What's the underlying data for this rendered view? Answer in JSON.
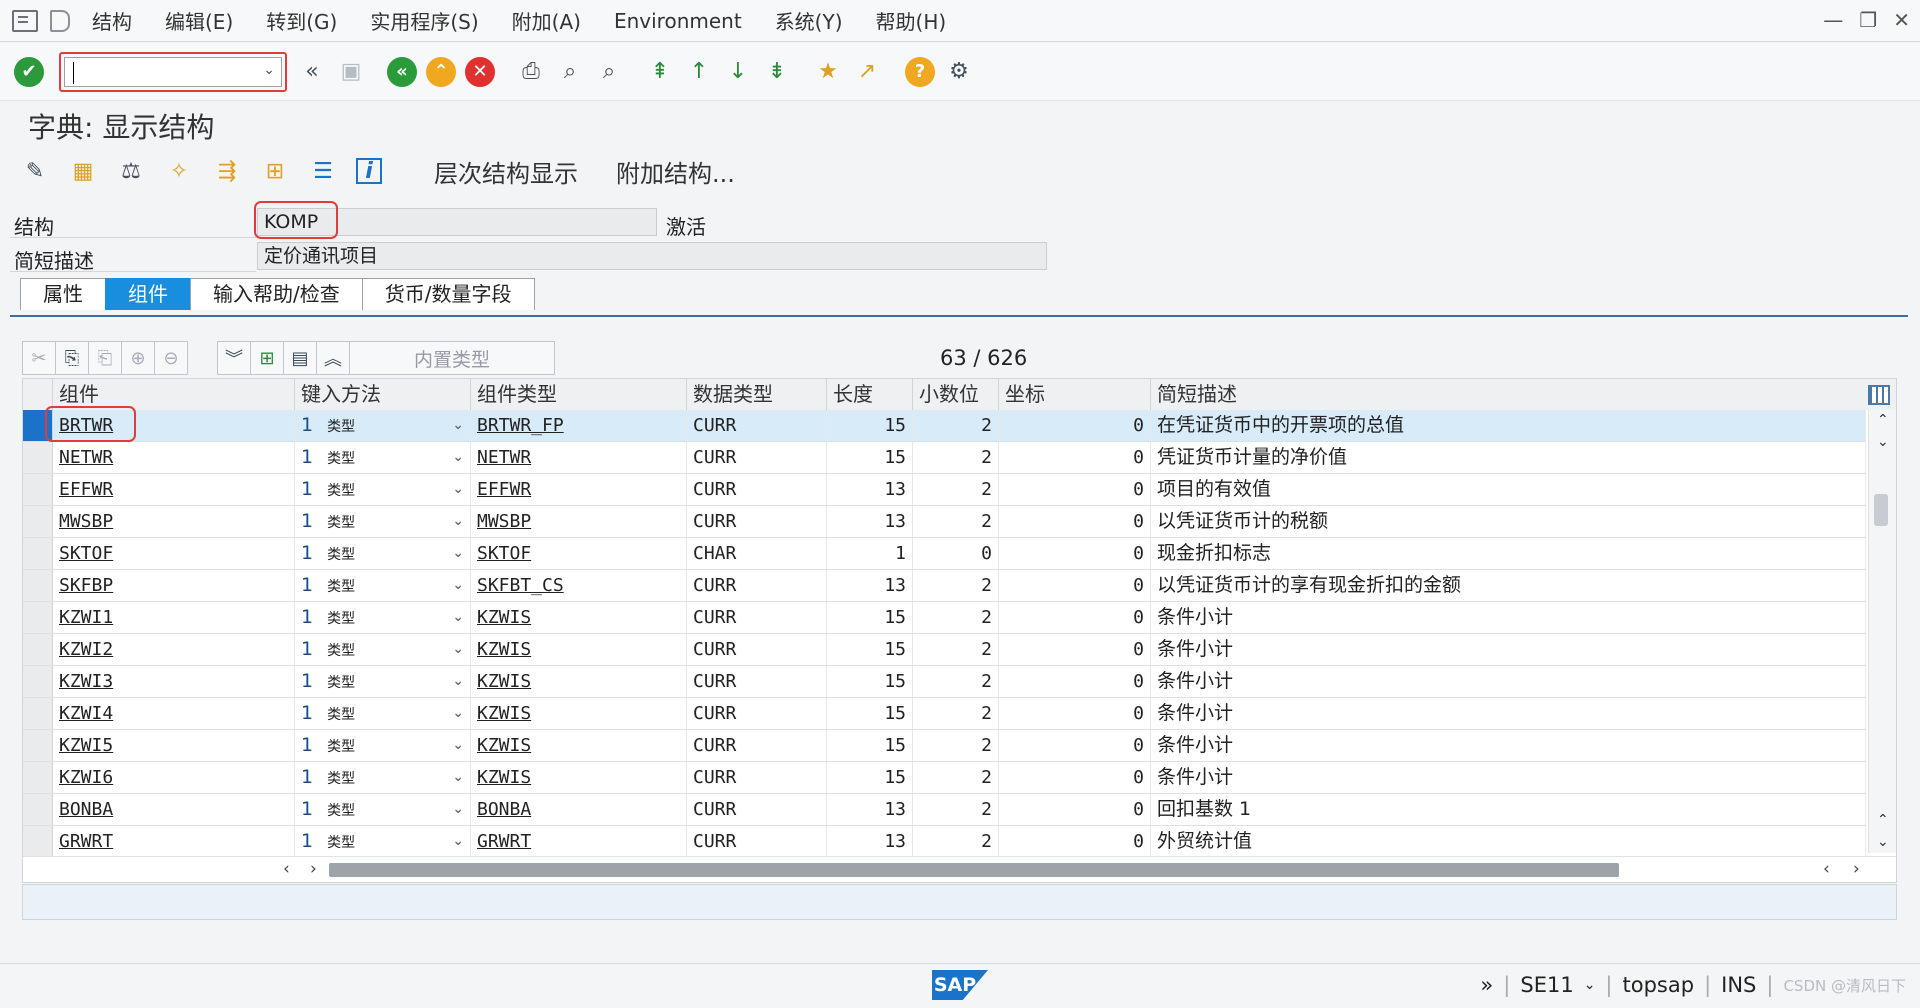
{
  "menu": {
    "items": [
      "结构",
      "编辑(E)",
      "转到(G)",
      "实用程序(S)",
      "附加(A)",
      "Environment",
      "系统(Y)",
      "帮助(H)"
    ]
  },
  "window_controls": [
    "—",
    "❐",
    "✕"
  ],
  "toolbar": {
    "command_value": "",
    "icons": [
      "enter-icon",
      "command-field",
      "back-arrows-icon",
      "save-icon",
      "back-icon",
      "exit-icon",
      "cancel-icon",
      "print-icon",
      "find-icon",
      "find-next-icon",
      "first-page-icon",
      "prev-page-icon",
      "next-page-icon",
      "last-page-icon",
      "create-session-icon",
      "shortcut-icon",
      "help-icon",
      "settings-icon"
    ]
  },
  "title": "字典: 显示结构",
  "app_toolbar": {
    "hierarchy_label": "层次结构显示",
    "append_label": "附加结构..."
  },
  "header": {
    "structure_label": "结构",
    "structure_value": "KOMP",
    "status": "激活",
    "desc_label": "简短描述",
    "desc_value": "定价通讯项目"
  },
  "tabs": [
    {
      "label": "属性",
      "active": false
    },
    {
      "label": "组件",
      "active": true
    },
    {
      "label": "输入帮助/检查",
      "active": false
    },
    {
      "label": "货币/数量字段",
      "active": false
    }
  ],
  "table_toolbar": {
    "predefined_type_label": "内置类型",
    "counter": "63  /  626"
  },
  "grid": {
    "columns": [
      "组件",
      "键入方法",
      "组件类型",
      "数据类型",
      "长度",
      "小数位",
      "坐标",
      "简短描述"
    ],
    "rows": [
      {
        "comp": "BRTWR",
        "typing": "1",
        "kind": "类型",
        "ctype": "BRTWR_FP",
        "dtype": "CURR",
        "len": "15",
        "dec": "2",
        "coord": "0",
        "desc": "在凭证货币中的开票项的总值",
        "selected": true
      },
      {
        "comp": "NETWR",
        "typing": "1",
        "kind": "类型",
        "ctype": "NETWR",
        "dtype": "CURR",
        "len": "15",
        "dec": "2",
        "coord": "0",
        "desc": "凭证货币计量的净价值"
      },
      {
        "comp": "EFFWR",
        "typing": "1",
        "kind": "类型",
        "ctype": "EFFWR",
        "dtype": "CURR",
        "len": "13",
        "dec": "2",
        "coord": "0",
        "desc": "项目的有效值"
      },
      {
        "comp": "MWSBP",
        "typing": "1",
        "kind": "类型",
        "ctype": "MWSBP",
        "dtype": "CURR",
        "len": "13",
        "dec": "2",
        "coord": "0",
        "desc": "以凭证货币计的税额"
      },
      {
        "comp": "SKTOF",
        "typing": "1",
        "kind": "类型",
        "ctype": "SKTOF",
        "dtype": "CHAR",
        "len": "1",
        "dec": "0",
        "coord": "0",
        "desc": "现金折扣标志"
      },
      {
        "comp": "SKFBP",
        "typing": "1",
        "kind": "类型",
        "ctype": "SKFBT_CS",
        "dtype": "CURR",
        "len": "13",
        "dec": "2",
        "coord": "0",
        "desc": "以凭证货币计的享有现金折扣的金额"
      },
      {
        "comp": "KZWI1",
        "typing": "1",
        "kind": "类型",
        "ctype": "KZWIS",
        "dtype": "CURR",
        "len": "15",
        "dec": "2",
        "coord": "0",
        "desc": "条件小计"
      },
      {
        "comp": "KZWI2",
        "typing": "1",
        "kind": "类型",
        "ctype": "KZWIS",
        "dtype": "CURR",
        "len": "15",
        "dec": "2",
        "coord": "0",
        "desc": "条件小计"
      },
      {
        "comp": "KZWI3",
        "typing": "1",
        "kind": "类型",
        "ctype": "KZWIS",
        "dtype": "CURR",
        "len": "15",
        "dec": "2",
        "coord": "0",
        "desc": "条件小计"
      },
      {
        "comp": "KZWI4",
        "typing": "1",
        "kind": "类型",
        "ctype": "KZWIS",
        "dtype": "CURR",
        "len": "15",
        "dec": "2",
        "coord": "0",
        "desc": "条件小计"
      },
      {
        "comp": "KZWI5",
        "typing": "1",
        "kind": "类型",
        "ctype": "KZWIS",
        "dtype": "CURR",
        "len": "15",
        "dec": "2",
        "coord": "0",
        "desc": "条件小计"
      },
      {
        "comp": "KZWI6",
        "typing": "1",
        "kind": "类型",
        "ctype": "KZWIS",
        "dtype": "CURR",
        "len": "15",
        "dec": "2",
        "coord": "0",
        "desc": "条件小计"
      },
      {
        "comp": "BONBA",
        "typing": "1",
        "kind": "类型",
        "ctype": "BONBA",
        "dtype": "CURR",
        "len": "13",
        "dec": "2",
        "coord": "0",
        "desc": "回扣基数 1"
      },
      {
        "comp": "GRWRT",
        "typing": "1",
        "kind": "类型",
        "ctype": "GRWRT",
        "dtype": "CURR",
        "len": "13",
        "dec": "2",
        "coord": "0",
        "desc": "外贸统计值"
      }
    ]
  },
  "status": {
    "tcode": "SE11",
    "server": "topsap",
    "mode": "INS",
    "watermark": "CSDN @清风日下",
    "logo_text": "SAP"
  },
  "colors": {
    "accent": "#1a8ede",
    "selected_row": "#d7ebf9",
    "highlight_box": "#e03c3c"
  }
}
